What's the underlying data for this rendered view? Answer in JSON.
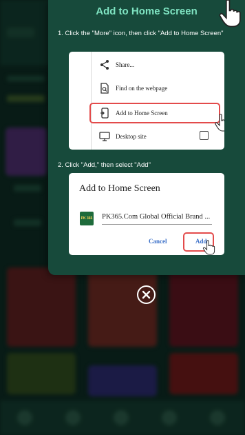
{
  "panel": {
    "title": "Add to Home Screen",
    "step1": "1. Click the \"More\" icon, then click \"Add to Home Screen\"",
    "step2": "2. Click \"Add,\" then select \"Add\""
  },
  "browser_menu": {
    "items": [
      {
        "label": "Share...",
        "icon": "share-icon"
      },
      {
        "label": "Find on the webpage",
        "icon": "find-in-page-icon"
      },
      {
        "label": "Add to Home Screen",
        "icon": "add-to-home-icon"
      },
      {
        "label": "Desktop site",
        "icon": "desktop-icon"
      }
    ]
  },
  "dialog": {
    "title": "Add to Home Screen",
    "app_name": "PK365.Com Global Official Brand ...",
    "app_icon_text": "PK 365",
    "cancel_label": "Cancel",
    "add_label": "Add"
  },
  "colors": {
    "panel_bg": "#174a3b",
    "title": "#7fe4c2",
    "highlight": "#e34b4b",
    "link": "#3a6fc8"
  }
}
